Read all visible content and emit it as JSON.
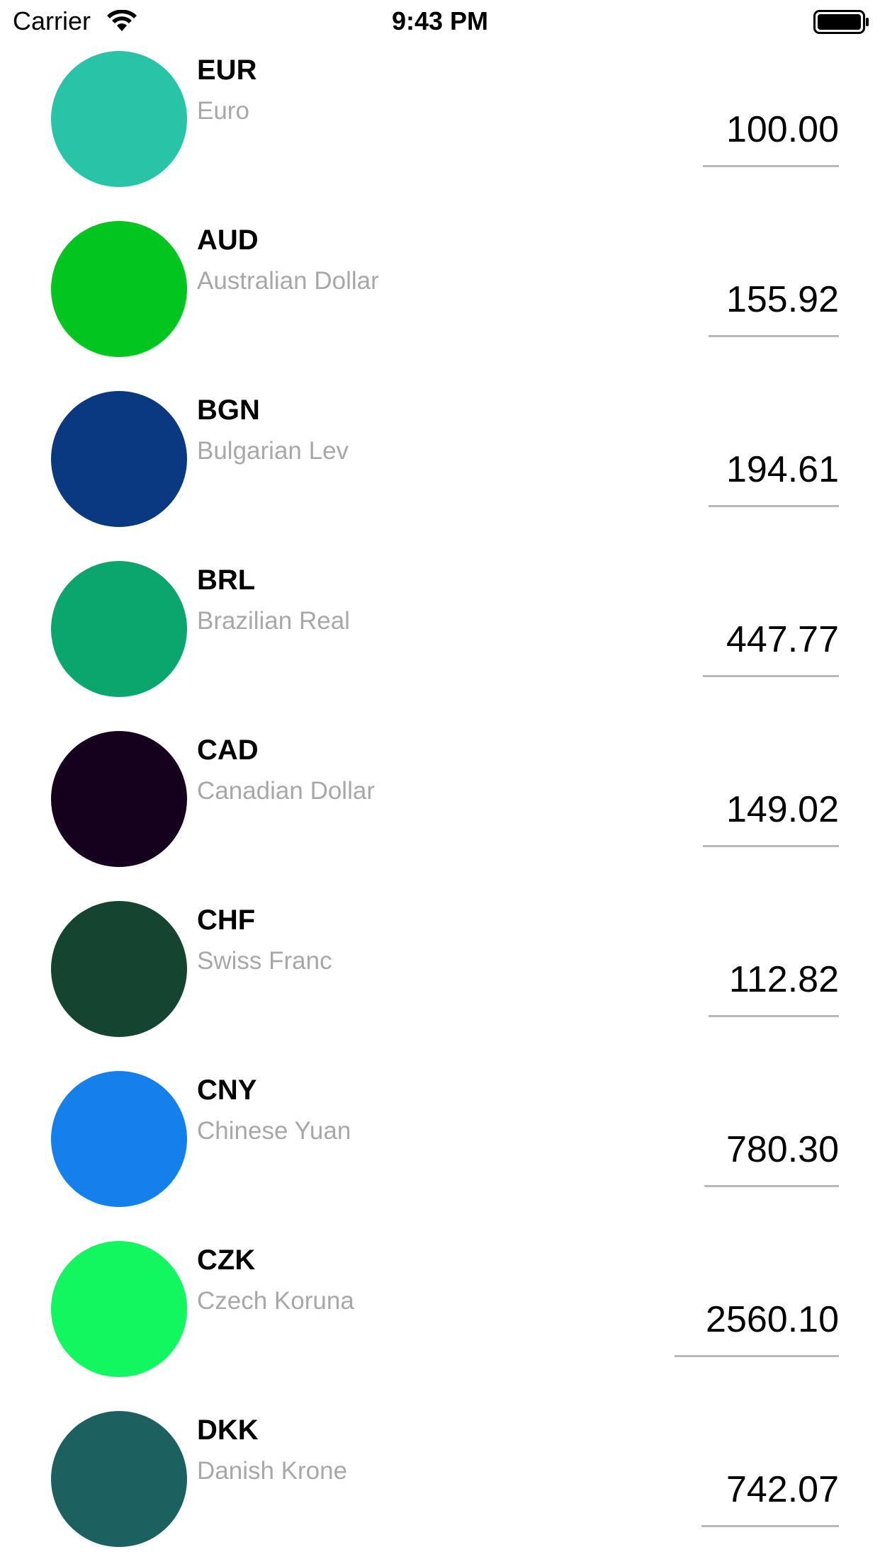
{
  "status_bar": {
    "carrier": "Carrier",
    "time": "9:43 PM",
    "icons": [
      "wifi-icon",
      "battery-icon"
    ]
  },
  "currencies": [
    {
      "code": "EUR",
      "name": "Euro",
      "amount": "100.00",
      "flag_color": "#29C4A8"
    },
    {
      "code": "AUD",
      "name": "Australian Dollar",
      "amount": "155.92",
      "flag_color": "#03C51F"
    },
    {
      "code": "BGN",
      "name": "Bulgarian Lev",
      "amount": "194.61",
      "flag_color": "#0B3981"
    },
    {
      "code": "BRL",
      "name": "Brazilian Real",
      "amount": "447.77",
      "flag_color": "#0BA66E"
    },
    {
      "code": "CAD",
      "name": "Canadian Dollar",
      "amount": "149.02",
      "flag_color": "#15001D"
    },
    {
      "code": "CHF",
      "name": "Swiss Franc",
      "amount": "112.82",
      "flag_color": "#154530"
    },
    {
      "code": "CNY",
      "name": "Chinese Yuan",
      "amount": "780.30",
      "flag_color": "#1580EB"
    },
    {
      "code": "CZK",
      "name": "Czech Koruna",
      "amount": "2560.10",
      "flag_color": "#12F760"
    },
    {
      "code": "DKK",
      "name": "Danish Krone",
      "amount": "742.07",
      "flag_color": "#1C6160"
    }
  ]
}
